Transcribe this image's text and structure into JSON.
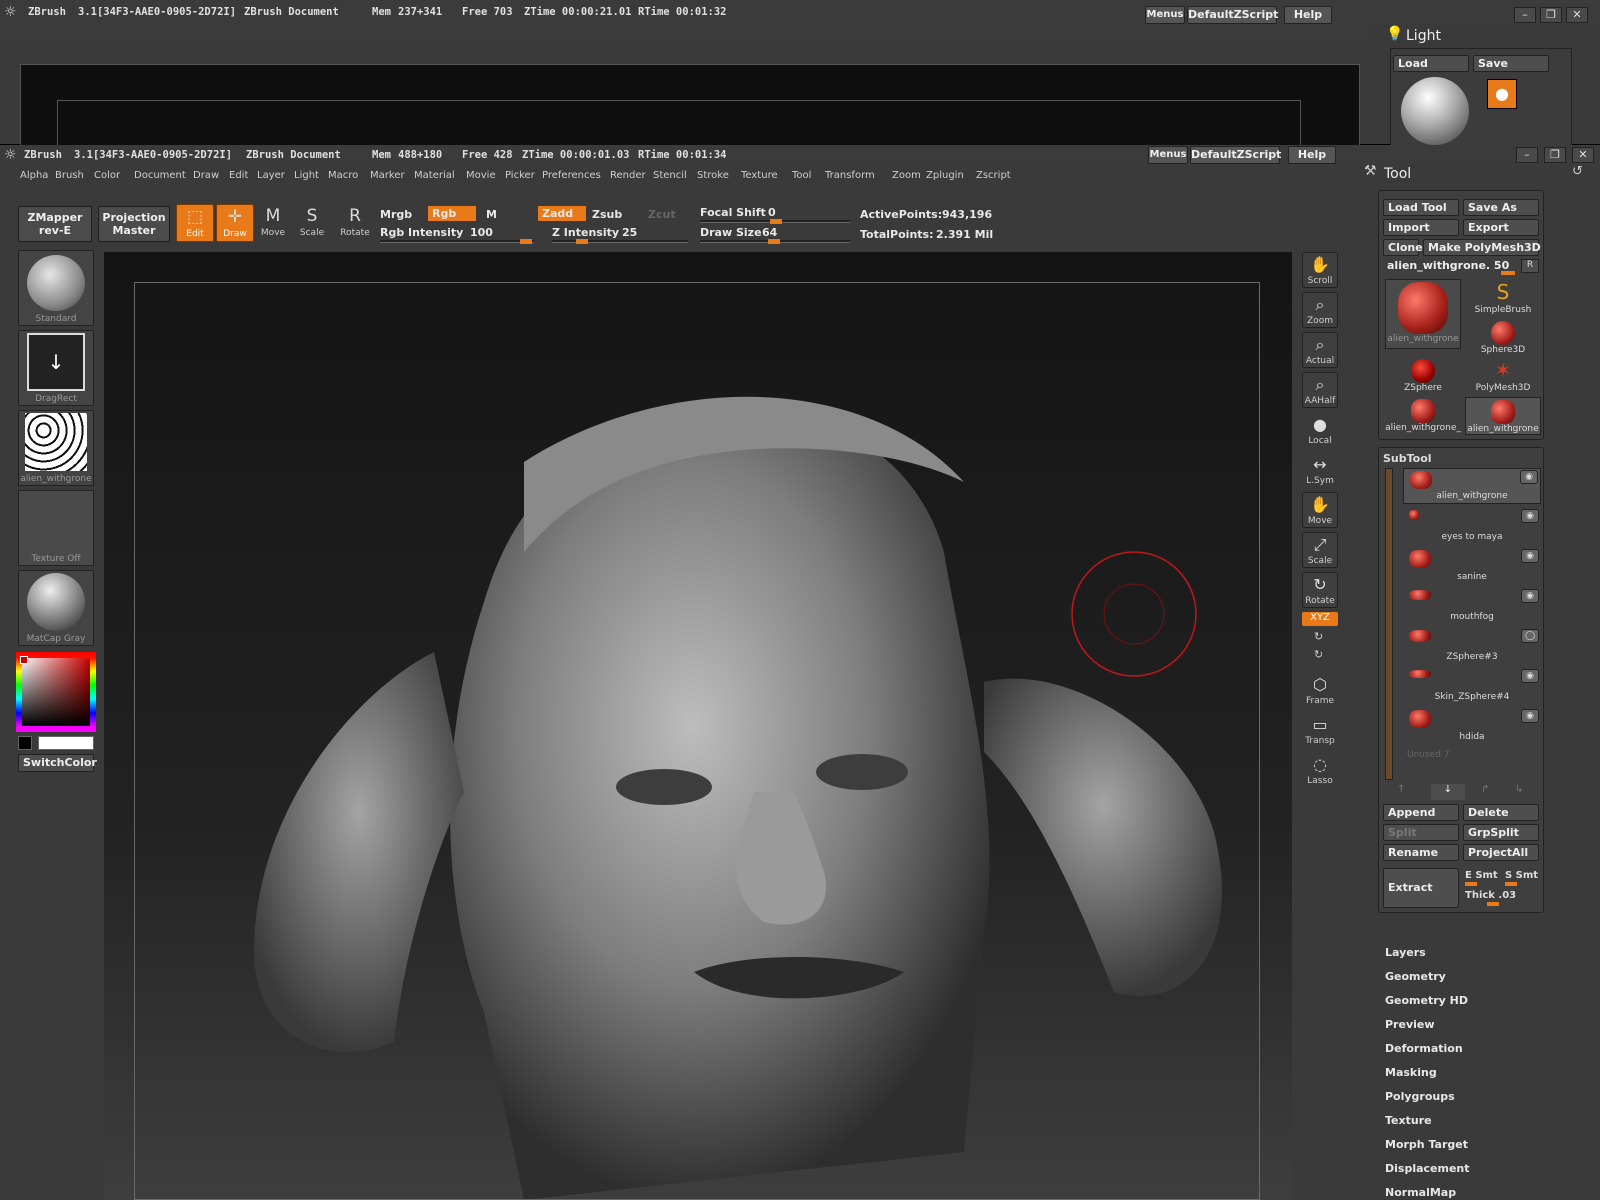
{
  "back_window": {
    "title": "ZBrush",
    "version": "3.1[34F3-AAE0-0905-2D72I]",
    "doc": "ZBrush Document",
    "mem_label": "Mem",
    "mem": "237+341",
    "free": "Free 703",
    "ztime": "ZTime 00:00:21.01",
    "rtime": "RTime 00:01:32",
    "menus_label": "Menus",
    "script_label": "DefaultZScript",
    "help_label": "Help",
    "light_title": "Light",
    "light_load": "Load",
    "light_save": "Save"
  },
  "main_window": {
    "title": "ZBrush",
    "version": "3.1[34F3-AAE0-0905-2D72I]",
    "doc": "ZBrush Document",
    "mem_label": "Mem",
    "mem": "488+180",
    "free": "Free 428",
    "ztime": "ZTime 00:00:01.03",
    "rtime": "RTime 00:01:34",
    "menus_label": "Menus",
    "script_label": "DefaultZScript",
    "help_label": "Help"
  },
  "menu_items": [
    "Alpha",
    "Brush",
    "Color",
    "Document",
    "Draw",
    "Edit",
    "Layer",
    "Light",
    "Macro",
    "Marker",
    "Material",
    "Movie",
    "Picker",
    "Preferences",
    "Render",
    "Stencil",
    "Stroke",
    "Texture",
    "Tool",
    "Transform",
    "Zoom",
    "Zplugin",
    "Zscript"
  ],
  "toolbar": {
    "zmapper": "ZMapper",
    "zmapper_sub": "rev-E",
    "projection": "Projection",
    "projection_sub": "Master",
    "edit": "Edit",
    "draw": "Draw",
    "move": "Move",
    "scale": "Scale",
    "rotate": "Rotate",
    "mrgb": "Mrgb",
    "rgb": "Rgb",
    "m": "M",
    "rgb_intensity_label": "Rgb Intensity",
    "rgb_intensity": "100",
    "zadd": "Zadd",
    "zsub": "Zsub",
    "zcut": "Zcut",
    "z_intensity_label": "Z Intensity",
    "z_intensity": "25",
    "focal_shift_label": "Focal Shift",
    "focal_shift": "0",
    "draw_size_label": "Draw Size",
    "draw_size": "64",
    "active_points_label": "ActivePoints:",
    "active_points": "943,196",
    "total_points_label": "TotalPoints:",
    "total_points": "2.391 Mil"
  },
  "left_shelf": {
    "brush": "Standard",
    "stroke": "DragRect",
    "alpha": "alien_withgrone",
    "texture": "Texture Off",
    "material": "MatCap Gray",
    "switch_color": "SwitchColor"
  },
  "right_dock": [
    "Scroll",
    "Zoom",
    "Actual",
    "AAHalf",
    "Local",
    "L.Sym",
    "Move",
    "Scale",
    "Rotate",
    "XYZ",
    "Frame",
    "Transp",
    "Lasso"
  ],
  "tool_panel": {
    "title": "Tool",
    "load_tool": "Load Tool",
    "save_as": "Save As",
    "import": "Import",
    "export": "Export",
    "clone": "Clone",
    "make_polymesh": "Make PolyMesh3D",
    "current_tool": "alien_withgrone. 50",
    "r": "R",
    "thumbs": [
      "alien_withgrone",
      "SimpleBrush",
      "Sphere3D",
      "ZSphere",
      "PolyMesh3D",
      "alien_withgrone_",
      "alien_withgrone"
    ]
  },
  "subtool": {
    "title": "SubTool",
    "items": [
      "alien_withgrone",
      "eyes to maya",
      "sanine",
      "mouthfog",
      "ZSphere#3",
      "Skin_ZSphere#4",
      "hdida"
    ],
    "unused": "Unused 7",
    "append": "Append",
    "delete": "Delete",
    "split": "Split",
    "grpsplit": "GrpSplit",
    "rename": "Rename",
    "projectall": "ProjectAll",
    "extract": "Extract",
    "esmt": "E Smt",
    "ssmt": "S Smt",
    "thick": "Thick .03"
  },
  "sections": [
    "Layers",
    "Geometry",
    "Geometry HD",
    "Preview",
    "Deformation",
    "Masking",
    "Polygroups",
    "Texture",
    "Morph Target",
    "Displacement",
    "NormalMap"
  ],
  "colors": {
    "accent": "#e87a1a",
    "bg": "#3a3a3a",
    "canvas": "#141414"
  }
}
